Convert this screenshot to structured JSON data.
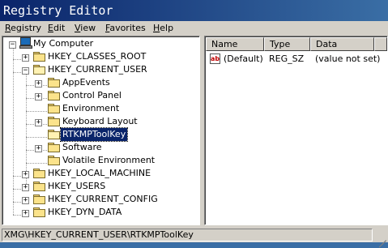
{
  "window": {
    "title": "Registry Editor"
  },
  "menu": [
    {
      "key": "R",
      "rest": "egistry"
    },
    {
      "key": "E",
      "rest": "dit"
    },
    {
      "key": "V",
      "rest": "iew"
    },
    {
      "key": "F",
      "rest": "avorites"
    },
    {
      "key": "H",
      "rest": "elp"
    }
  ],
  "tree": {
    "root": "My Computer",
    "hives": [
      "HKEY_CLASSES_ROOT",
      "HKEY_CURRENT_USER",
      "HKEY_LOCAL_MACHINE",
      "HKEY_USERS",
      "HKEY_CURRENT_CONFIG",
      "HKEY_DYN_DATA"
    ],
    "current_user_children": [
      "AppEvents",
      "Control Panel",
      "Environment",
      "Keyboard Layout",
      "RTKMPToolKey",
      "Software",
      "Volatile Environment"
    ],
    "selected": "RTKMPToolKey"
  },
  "list": {
    "columns": [
      "Name",
      "Type",
      "Data"
    ],
    "rows": [
      {
        "icon": "ab",
        "name": "(Default)",
        "type": "REG_SZ",
        "data": "(value not set)"
      }
    ]
  },
  "status": {
    "path": "XMG\\HKEY_CURRENT_USER\\RTKMPToolKey"
  }
}
